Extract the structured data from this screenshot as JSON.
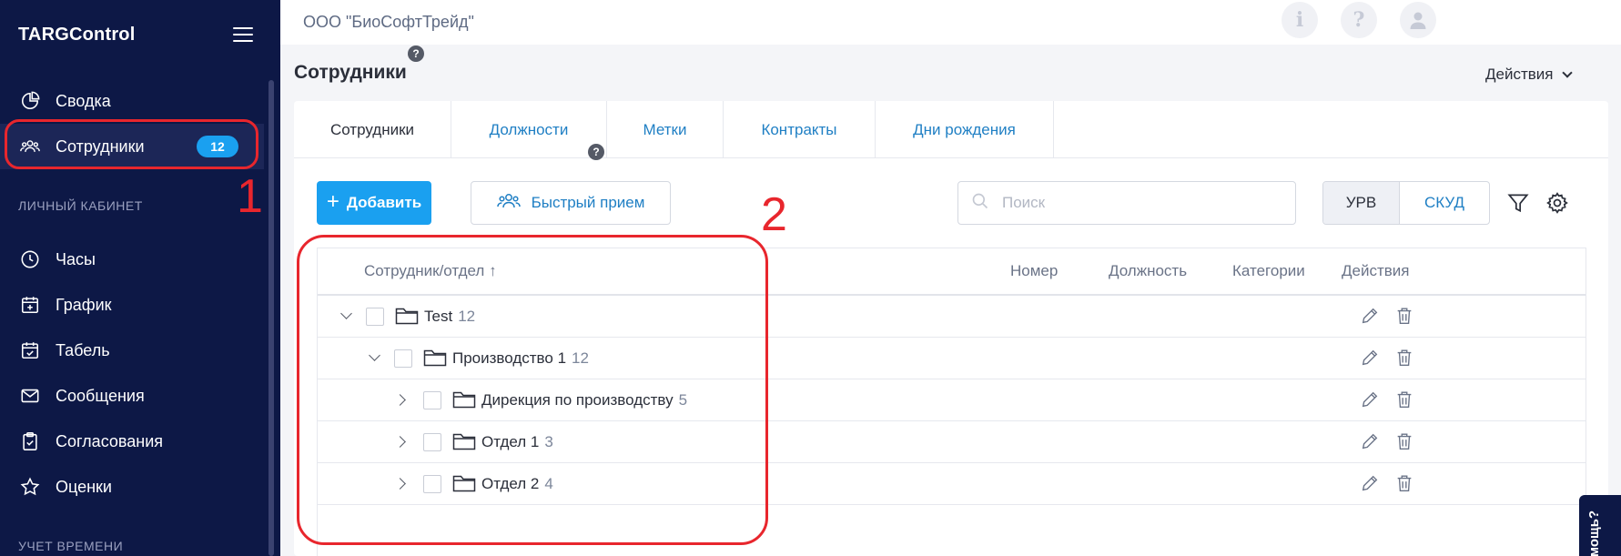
{
  "app": {
    "logo": "TARGControl",
    "organization": "ООО \"БиоСофтТрейд\""
  },
  "sidebar": {
    "items": [
      {
        "label": "Сводка",
        "icon": "pie-chart-icon"
      },
      {
        "label": "Сотрудники",
        "icon": "users-icon",
        "badge": "12",
        "active": true
      }
    ],
    "section_personal": "ЛИЧНЫЙ КАБИНЕТ",
    "personal_items": [
      {
        "label": "Часы",
        "icon": "clock-icon"
      },
      {
        "label": "График",
        "icon": "calendar-plus-icon"
      },
      {
        "label": "Табель",
        "icon": "calendar-check-icon"
      },
      {
        "label": "Сообщения",
        "icon": "envelope-icon"
      },
      {
        "label": "Согласования",
        "icon": "clipboard-check-icon"
      },
      {
        "label": "Оценки",
        "icon": "star-icon"
      }
    ],
    "section_time": "УЧЕТ ВРЕМЕНИ"
  },
  "topbar": {
    "icons": [
      "info-icon",
      "question-icon",
      "user-icon"
    ]
  },
  "page": {
    "title": "Сотрудники",
    "help": "?",
    "actions_label": "Действия"
  },
  "tabs": [
    {
      "label": "Сотрудники",
      "active": true
    },
    {
      "label": "Должности"
    },
    {
      "label": "Метки"
    },
    {
      "label": "Контракты"
    },
    {
      "label": "Дни рождения"
    }
  ],
  "toolbar": {
    "add_plus": "+",
    "add_label": "Добавить",
    "quick_label": "Быстрый прием",
    "help": "?",
    "search_placeholder": "Поиск",
    "seg_urv": "УРВ",
    "seg_skud": "СКУД"
  },
  "table": {
    "columns": {
      "employee": "Сотрудник/отдел ↑",
      "number": "Номер",
      "position": "Должность",
      "categories": "Категории",
      "actions": "Действия"
    },
    "rows": [
      {
        "name": "Test",
        "count": "12",
        "level": 0,
        "expanded": true
      },
      {
        "name": "Производство 1",
        "count": "12",
        "level": 1,
        "expanded": true
      },
      {
        "name": "Дирекция по производству",
        "count": "5",
        "level": 2,
        "expanded": false
      },
      {
        "name": "Отдел 1",
        "count": "3",
        "level": 2,
        "expanded": false
      },
      {
        "name": "Отдел 2",
        "count": "4",
        "level": 2,
        "expanded": false
      }
    ]
  },
  "annotations": {
    "n1": "1",
    "n2": "2",
    "color": "#e8262d"
  },
  "help_tab": "мощь?"
}
